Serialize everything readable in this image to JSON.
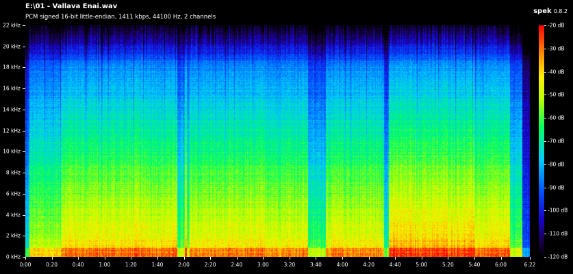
{
  "header": {
    "file_title": "E:\\01 - Vallava Enai.wav",
    "file_info": "PCM signed 16-bit little-endian, 1411 kbps, 44100 Hz, 2 channels",
    "app_name": "spek",
    "app_version": "0.8.2"
  },
  "spectrogram": {
    "duration_label": "6:22",
    "freq_axis": [
      "0 kHz",
      "2 kHz",
      "4 kHz",
      "6 kHz",
      "8 kHz",
      "10 kHz",
      "12 kHz",
      "14 kHz",
      "16 kHz",
      "18 kHz",
      "20 kHz",
      "22 kHz"
    ],
    "freq_values_khz": [
      0,
      2,
      4,
      6,
      8,
      10,
      12,
      14,
      16,
      18,
      20,
      22
    ],
    "freq_max_khz": 22,
    "time_axis": [
      "0:00",
      "0:20",
      "0:40",
      "1:00",
      "1:20",
      "1:40",
      "2:00",
      "2:20",
      "2:40",
      "3:00",
      "3:20",
      "3:40",
      "4:00",
      "4:20",
      "4:40",
      "5:00",
      "5:20",
      "5:40",
      "6:00",
      "6:22"
    ],
    "time_values_s": [
      0,
      20,
      40,
      60,
      80,
      100,
      120,
      140,
      160,
      180,
      200,
      220,
      240,
      260,
      280,
      300,
      320,
      340,
      360,
      382
    ],
    "time_max_s": 382,
    "db_scale": [
      "-20 dB",
      "-30 dB",
      "-40 dB",
      "-50 dB",
      "-60 dB",
      "-70 dB",
      "-80 dB",
      "-90 dB",
      "-100 dB",
      "-110 dB",
      "-120 dB"
    ],
    "db_values": [
      -20,
      -30,
      -40,
      -50,
      -60,
      -70,
      -80,
      -90,
      -100,
      -110,
      -120
    ],
    "db_range": [
      -120,
      -20
    ]
  }
}
